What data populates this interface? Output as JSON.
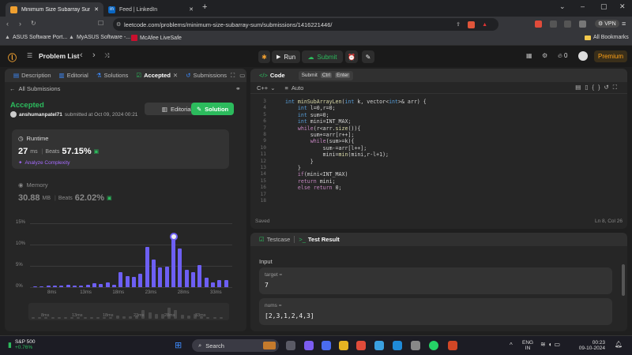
{
  "browser": {
    "tabs": [
      {
        "title": "Minimum Size Subarray Sum -"
      },
      {
        "title": "Feed | LinkedIn"
      }
    ],
    "url": "leetcode.com/problems/minimum-size-subarray-sum/submissions/1416221446/",
    "vpn": "VPN",
    "bookmarks": [
      "ASUS Software Port...",
      "MyASUS Software -...",
      "McAfee LiveSafe"
    ],
    "all_bookmarks": "All Bookmarks"
  },
  "lc": {
    "problem_list": "Problem List",
    "run": "Run",
    "submit": "Submit",
    "streak": "0",
    "premium": "Premium"
  },
  "left": {
    "tabs": [
      "Description",
      "Editorial",
      "Solutions",
      "Accepted",
      "Submissions"
    ],
    "all_submissions": "All Submissions",
    "status": "Accepted",
    "user": "anshumanpatel71",
    "submitted": "submitted at Oct 09, 2024 00:21",
    "editorial_btn": "Editorial",
    "solution_btn": "Solution",
    "runtime_label": "Runtime",
    "runtime_value": "27",
    "runtime_unit": "ms",
    "beats_label": "Beats",
    "runtime_beats": "57.15%",
    "analyze": "Analyze Complexity",
    "memory_label": "Memory",
    "memory_value": "30.88",
    "memory_unit": "MB",
    "memory_beats": "62.02%"
  },
  "chart_data": {
    "type": "bar",
    "y_ticks": [
      "15%",
      "10%",
      "5%",
      "0%"
    ],
    "ylim": [
      0,
      15
    ],
    "x_ticks": [
      "8ms",
      "13ms",
      "18ms",
      "23ms",
      "28ms",
      "33ms"
    ],
    "values": [
      0.2,
      0.2,
      0.3,
      0.3,
      0.3,
      0.5,
      0.3,
      0.4,
      0.5,
      0.9,
      0.7,
      1.2,
      0.6,
      3.6,
      2.6,
      2.5,
      3.1,
      9.5,
      6.4,
      4.7,
      4.8,
      11.8,
      9.1,
      4.1,
      3.6,
      5.1,
      2.2,
      1.2,
      1.7,
      1.6
    ],
    "highlight_index": 21,
    "mini_ticks": [
      "8ms",
      "13ms",
      "18ms",
      "23ms",
      "28ms",
      "33ms"
    ]
  },
  "editor": {
    "title": "Code",
    "tooltip": {
      "label": "Submit",
      "keys": [
        "Ctrl",
        "Enter"
      ]
    },
    "lang": "C++",
    "mode": "Auto",
    "line_numbers": [
      "3",
      "4",
      "5",
      "6",
      "7",
      "8",
      "9",
      "10",
      "11",
      "12",
      "13",
      "14",
      "15",
      "16",
      "17",
      "18"
    ],
    "saved": "Saved",
    "position": "Ln 8, Col 26"
  },
  "bottom": {
    "testcase_tab": "Testcase",
    "result_tab": "Test Result",
    "input_label": "Input",
    "target_label": "target =",
    "target_value": "7",
    "nums_label": "nums =",
    "nums_value": "[2,3,1,2,4,3]"
  },
  "taskbar": {
    "stock_name": "S&P 500",
    "stock_change": "+0.76%",
    "search": "Search",
    "lang1": "ENG",
    "lang2": "IN",
    "time": "00:23",
    "date": "09-10-2024"
  }
}
